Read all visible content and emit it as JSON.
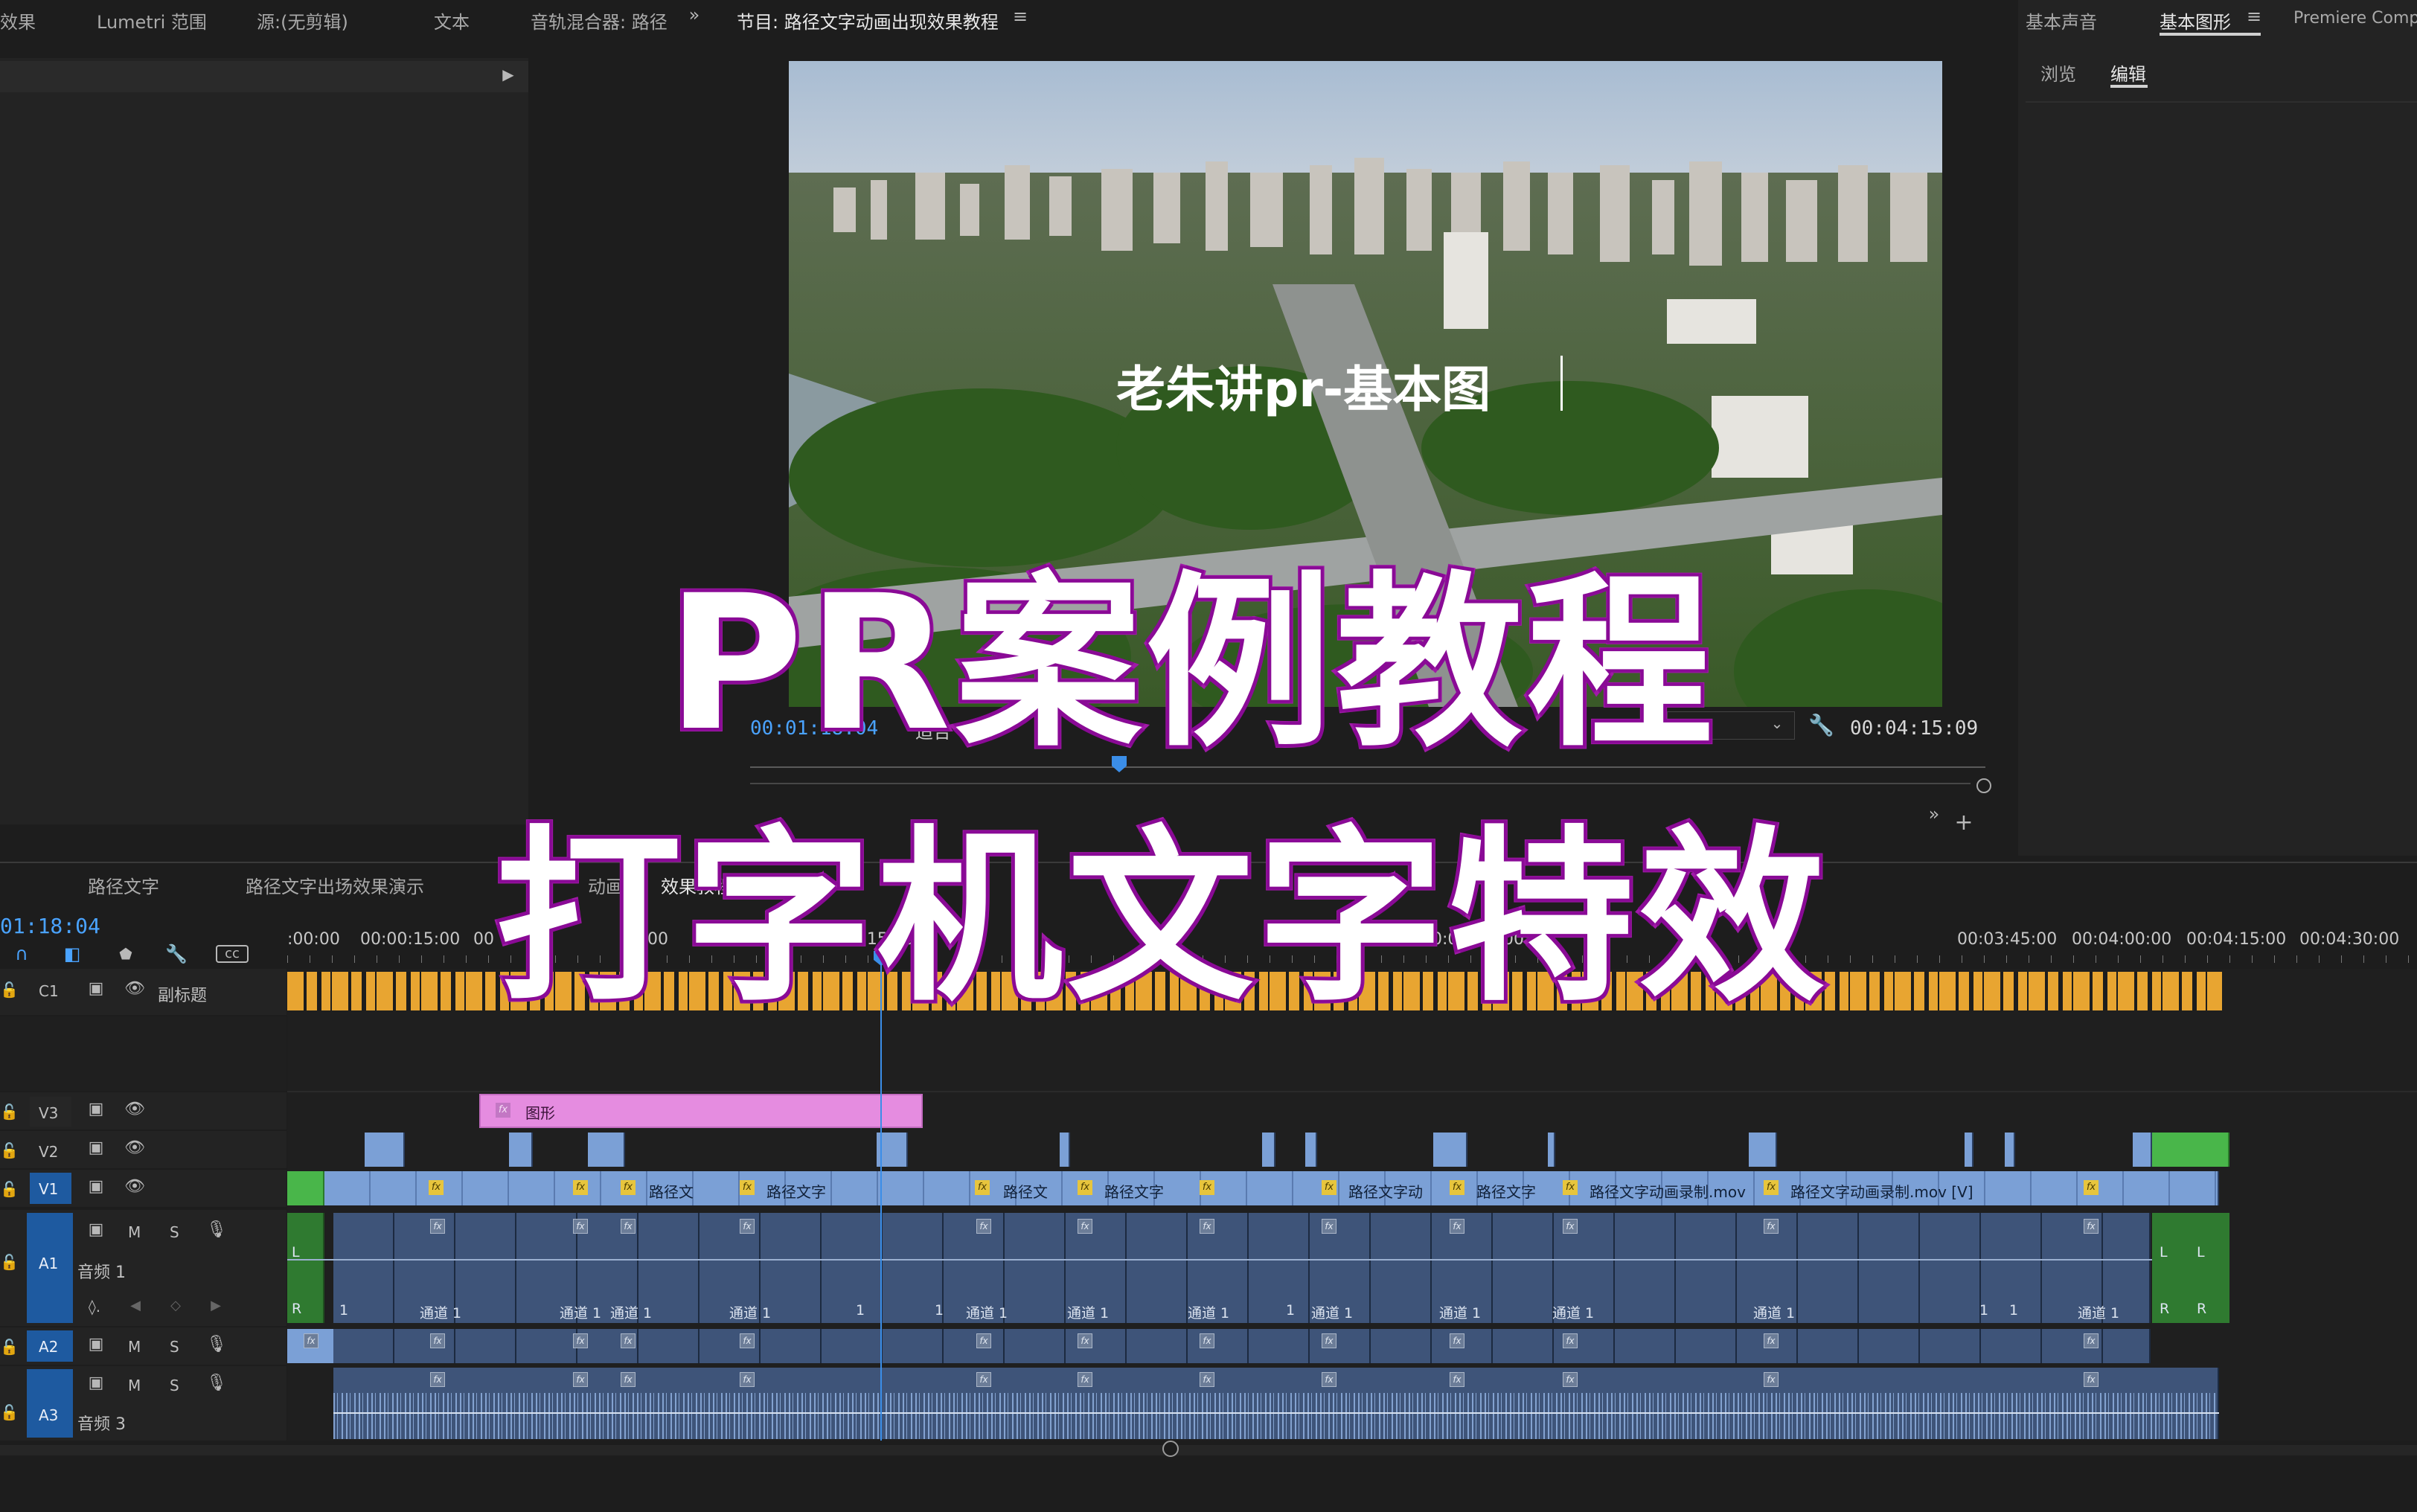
{
  "top_tabs": {
    "effects": "效果",
    "lumetri_scope": "Lumetri 范围",
    "source": "源:(无剪辑)",
    "text": "文本",
    "audio_mixer": "音轨混合器: 路径"
  },
  "program_monitor": {
    "title": "节目: 路径文字动画出现效果教程",
    "video_caption": "老朱讲pr-基本图",
    "current_timecode": "00:01:18:04",
    "fit_label": "适合",
    "duration_timecode": "00:04:15:09"
  },
  "right_panel": {
    "tab_basic_sound": "基本声音",
    "tab_essential_graphics": "基本图形",
    "tab_premiere_composer": "Premiere Compo",
    "subtab_browse": "浏览",
    "subtab_edit": "编辑"
  },
  "timeline": {
    "sequence_tabs": [
      "路径文字",
      "路径文字出场效果演示",
      "动画",
      "效果教程"
    ],
    "timecode": "01:18:04",
    "ruler_ticks": [
      ":00:00",
      "00:00:15:00",
      "00",
      "00",
      "00:01",
      "00:01:15:00",
      "15:00",
      "30:00",
      "00:02:",
      "00:03:45:00",
      "00:04:00:00",
      "00:04:15:00",
      "00:04:30:00"
    ],
    "tracks": {
      "c1": "C1",
      "c1_name": "副标题",
      "v3": "V3",
      "v2": "V2",
      "v1": "V1",
      "a1": "A1",
      "a1_name": "音频 1",
      "a2": "A2",
      "a3": "A3",
      "a3_name": "音频 3",
      "mute": "M",
      "solo": "S"
    },
    "graphic_clip": "图形",
    "v1_clip_labels": [
      "路径文",
      "路径文字",
      "路径文",
      "路径文字",
      "路径文字动",
      "路径文字",
      "路径文字动画录制.mov",
      "路径文字动画录制.mov [V]"
    ],
    "channel_label": "通道 1",
    "marker_l": "L",
    "marker_r": "R",
    "marker_1": "1"
  },
  "overlay": {
    "line1": "PR案例教程",
    "line2": "打字机文字特效"
  },
  "icons": {
    "panel_menu": "hamburger-icon",
    "expand": "double-chevron-icon",
    "add": "plus-icon",
    "wrench": "wrench-icon",
    "lock": "lock-icon",
    "eye": "eye-icon",
    "mic": "microphone-icon",
    "film": "film-icon"
  },
  "colors": {
    "playhead": "#3b8ee8",
    "timecode_blue": "#4aa3ff",
    "caption_clip": "#e8a531",
    "graphic_clip": "#e58ce0",
    "video_clip": "#7ba0d6",
    "audio_clip": "#3e5479",
    "green_clip": "#49b64a",
    "overlay_outline": "#a01aa8"
  }
}
